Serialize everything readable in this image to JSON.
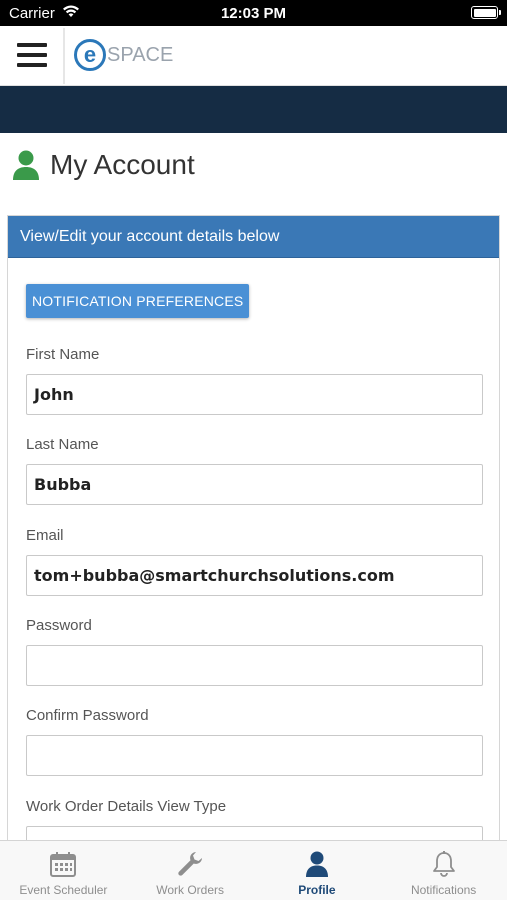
{
  "status_bar": {
    "carrier": "Carrier",
    "time": "12:03 PM"
  },
  "header": {
    "logo_letter": "e",
    "logo_text": "SPACE",
    "nav_band_color": "#152c44"
  },
  "page": {
    "title": "My Account",
    "title_icon": "user-icon",
    "accent_color": "#3a9a4a"
  },
  "card": {
    "header_text": "View/Edit your account details below",
    "header_color": "#3a78b6",
    "notification_button": "NOTIFICATION PREFERENCES",
    "fields": [
      {
        "label": "First Name",
        "value": "John"
      },
      {
        "label": "Last Name",
        "value": "Bubba"
      },
      {
        "label": "Email",
        "value": "tom+bubba@smartchurchsolutions.com"
      },
      {
        "label": "Password",
        "value": ""
      },
      {
        "label": "Confirm Password",
        "value": ""
      },
      {
        "label": "Work Order Details View Type",
        "value": ""
      }
    ]
  },
  "tab_bar": {
    "active_color": "#1f4a78",
    "tabs": [
      {
        "label": "Event Scheduler",
        "icon": "calendar-icon",
        "active": false
      },
      {
        "label": "Work Orders",
        "icon": "wrench-icon",
        "active": false
      },
      {
        "label": "Profile",
        "icon": "profile-icon",
        "active": true
      },
      {
        "label": "Notifications",
        "icon": "bell-icon",
        "active": false
      }
    ]
  }
}
